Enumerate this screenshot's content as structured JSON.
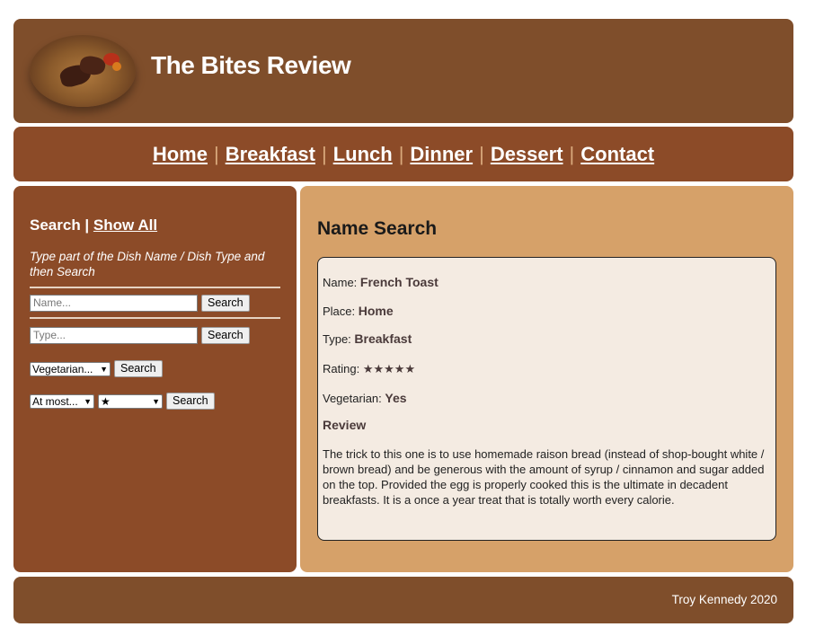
{
  "header": {
    "title": "The Bites Review",
    "logo_icon": "steak-plate-icon"
  },
  "nav": {
    "items": [
      "Home",
      "Breakfast",
      "Lunch",
      "Dinner",
      "Dessert",
      "Contact"
    ],
    "separator": "|"
  },
  "sidebar": {
    "search_label": "Search",
    "separator": " | ",
    "show_all_label": "Show All",
    "hint": "Type part of the Dish Name / Dish Type and then Search",
    "name_placeholder": "Name...",
    "type_placeholder": "Type...",
    "search_button": "Search",
    "vegetarian_select": "Vegetarian...",
    "rating_compare_select": "At most...",
    "rating_value_select": "★"
  },
  "main": {
    "heading": "Name Search",
    "name_label": "Name:",
    "name_value": "French Toast",
    "place_label": "Place:",
    "place_value": "Home",
    "type_label": "Type:",
    "type_value": "Breakfast",
    "rating_label": "Rating:",
    "rating_value": "★★★★★",
    "rating_stars": 5,
    "vegetarian_label": "Vegetarian:",
    "vegetarian_value": "Yes",
    "review_label": "Review",
    "review_text": "The trick to this one is to use homemade raison bread (instead of shop-bought white / brown bread) and be generous with the amount of syrup / cinnamon and sugar added on the top. Provided the egg is properly cooked this is the ultimate in decadent breakfasts. It is a once a year treat that is totally worth every calorie."
  },
  "footer": {
    "text": "Troy Kennedy 2020"
  },
  "colors": {
    "header_bg": "#7f4e2b",
    "nav_bg": "#8c4b28",
    "sidebar_bg": "#8c4b28",
    "main_bg": "#d6a169",
    "card_bg": "#f4ebe2",
    "footer_bg": "#7f4e2b"
  }
}
